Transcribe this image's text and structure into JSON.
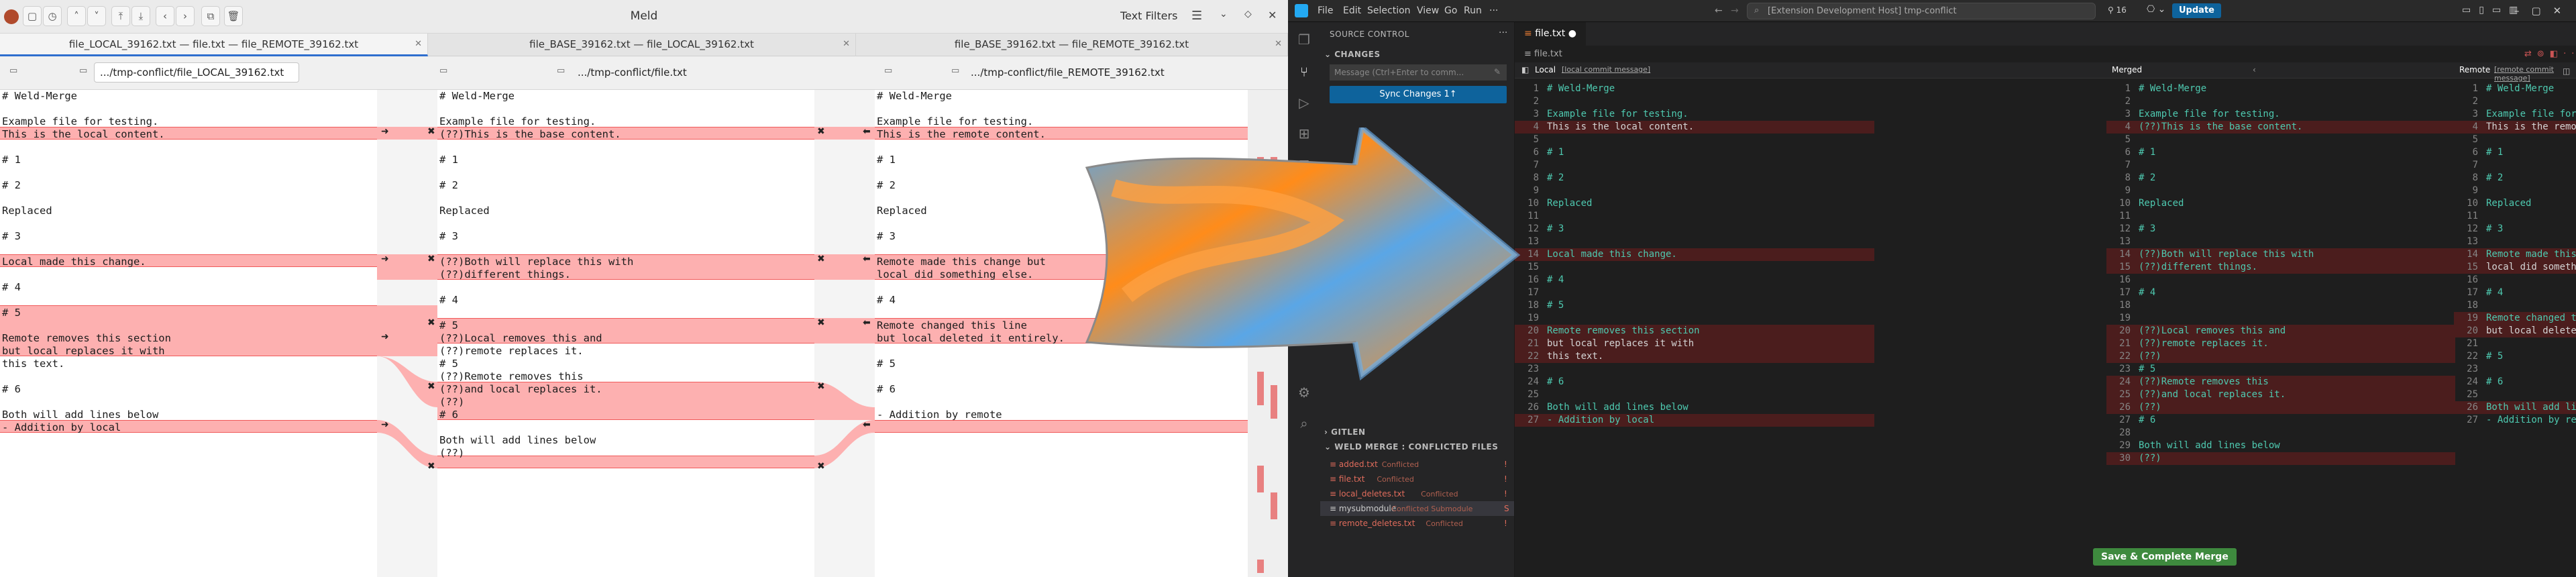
{
  "meld": {
    "title": "Meld",
    "text_filters": "Text Filters",
    "tabs": [
      "file_LOCAL_39162.txt — file.txt — file_REMOTE_39162.txt",
      "file_BASE_39162.txt — file_LOCAL_39162.txt",
      "file_BASE_39162.txt — file_REMOTE_39162.txt"
    ],
    "paths": [
      ".../tmp-conflict/file_LOCAL_39162.txt",
      ".../tmp-conflict/file.txt",
      ".../tmp-conflict/file_REMOTE_39162.txt"
    ],
    "left": [
      "# Weld-Merge",
      "",
      "Example file for testing.",
      "This is the local content.",
      "",
      "# 1",
      "",
      "# 2",
      "",
      "Replaced",
      "",
      "# 3",
      "",
      "Local made this change.",
      "",
      "# 4",
      "",
      "# 5",
      "",
      "Remote removes this section",
      "but local replaces it with",
      "this text.",
      "",
      "# 6",
      "",
      "Both will add lines below",
      "- Addition by local"
    ],
    "middle": [
      "# Weld-Merge",
      "",
      "Example file for testing.",
      "(??)This is the base content.",
      "",
      "# 1",
      "",
      "# 2",
      "",
      "Replaced",
      "",
      "# 3",
      "",
      "(??)Both will replace this with",
      "(??)different things.",
      "",
      "# 4",
      "",
      "# 5",
      "(??)Local removes this and",
      "(??)remote replaces it.",
      "# 5",
      "(??)Remote removes this",
      "(??)and local replaces it.",
      "(??)",
      "# 6",
      "",
      "Both will add lines below",
      "(??)"
    ],
    "right": [
      "# Weld-Merge",
      "",
      "Example file for testing.",
      "This is the remote content.",
      "",
      "# 1",
      "",
      "# 2",
      "",
      "Replaced",
      "",
      "# 3",
      "",
      "Remote made this change but",
      "local did something else.",
      "",
      "# 4",
      "",
      "Remote changed this line",
      "but local deleted it entirely.",
      "",
      "# 5",
      "",
      "# 6",
      "",
      "- Addition by remote"
    ]
  },
  "vscode": {
    "menu": [
      "File",
      "Edit",
      "Selection",
      "View",
      "Go",
      "Run",
      "···"
    ],
    "search": "[Extension Development Host] tmp-conflict",
    "update": "Update",
    "badge": "16",
    "source_control": "SOURCE CONTROL",
    "changes": "CHANGES",
    "message_placeholder": "Message (Ctrl+Enter to comm...",
    "sync": "Sync Changes 1↑",
    "gitlens": "GITLEN",
    "weld_header": "WELD MERGE : CONFLICTED FILES",
    "files": [
      {
        "name": "added.txt",
        "status": "Conflicted",
        "mark": "!"
      },
      {
        "name": "file.txt",
        "status": "Conflicted",
        "mark": "!"
      },
      {
        "name": "local_deletes.txt",
        "status": "Conflicted",
        "mark": "!"
      },
      {
        "name": "mysubmodule",
        "status": "Conflicted Submodule",
        "mark": "S"
      },
      {
        "name": "remote_deletes.txt",
        "status": "Conflicted",
        "mark": "!"
      }
    ],
    "editor_tab": "file.txt",
    "breadcrumb": "file.txt",
    "local_label": "Local",
    "local_sub": "[local commit message]",
    "merged_label": "Merged",
    "remote_label": "Remote",
    "remote_sub": "[remote commit message]",
    "complete": "Save & Complete Merge",
    "local_lines": [
      "# Weld-Merge",
      "",
      "Example file for testing.",
      "This is the local content.",
      "",
      "# 1",
      "",
      "# 2",
      "",
      "Replaced",
      "",
      "# 3",
      "",
      "Local made this change.",
      "",
      "# 4",
      "",
      "# 5",
      "",
      "Remote removes this section",
      "but local replaces it with",
      "this text.",
      "",
      "# 6",
      "",
      "Both will add lines below",
      "- Addition by local"
    ],
    "merged_lines": [
      "# Weld-Merge",
      "",
      "Example file for testing.",
      "(??)This is the base content.",
      "",
      "# 1",
      "",
      "# 2",
      "",
      "Replaced",
      "",
      "# 3",
      "",
      "(??)Both will replace this with",
      "(??)different things.",
      "",
      "# 4",
      "",
      "",
      "(??)Local removes this and",
      "(??)remote replaces it.",
      "(??)",
      "# 5",
      "(??)Remote removes this",
      "(??)and local replaces it.",
      "(??)",
      "# 6",
      "",
      "Both will add lines below",
      "(??)"
    ],
    "remote_lines": [
      "# Weld-Merge",
      "",
      "Example file for testing.",
      "This is the remote content.",
      "",
      "# 1",
      "",
      "# 2",
      "",
      "Replaced",
      "",
      "# 3",
      "",
      "Remote made this change but",
      "local did something else.",
      "",
      "# 4",
      "",
      "Remote changed this line",
      "but local deleted it entirely.",
      "",
      "# 5",
      "",
      "# 6",
      "",
      "Both will add lines below",
      "- Addition by remote"
    ]
  }
}
